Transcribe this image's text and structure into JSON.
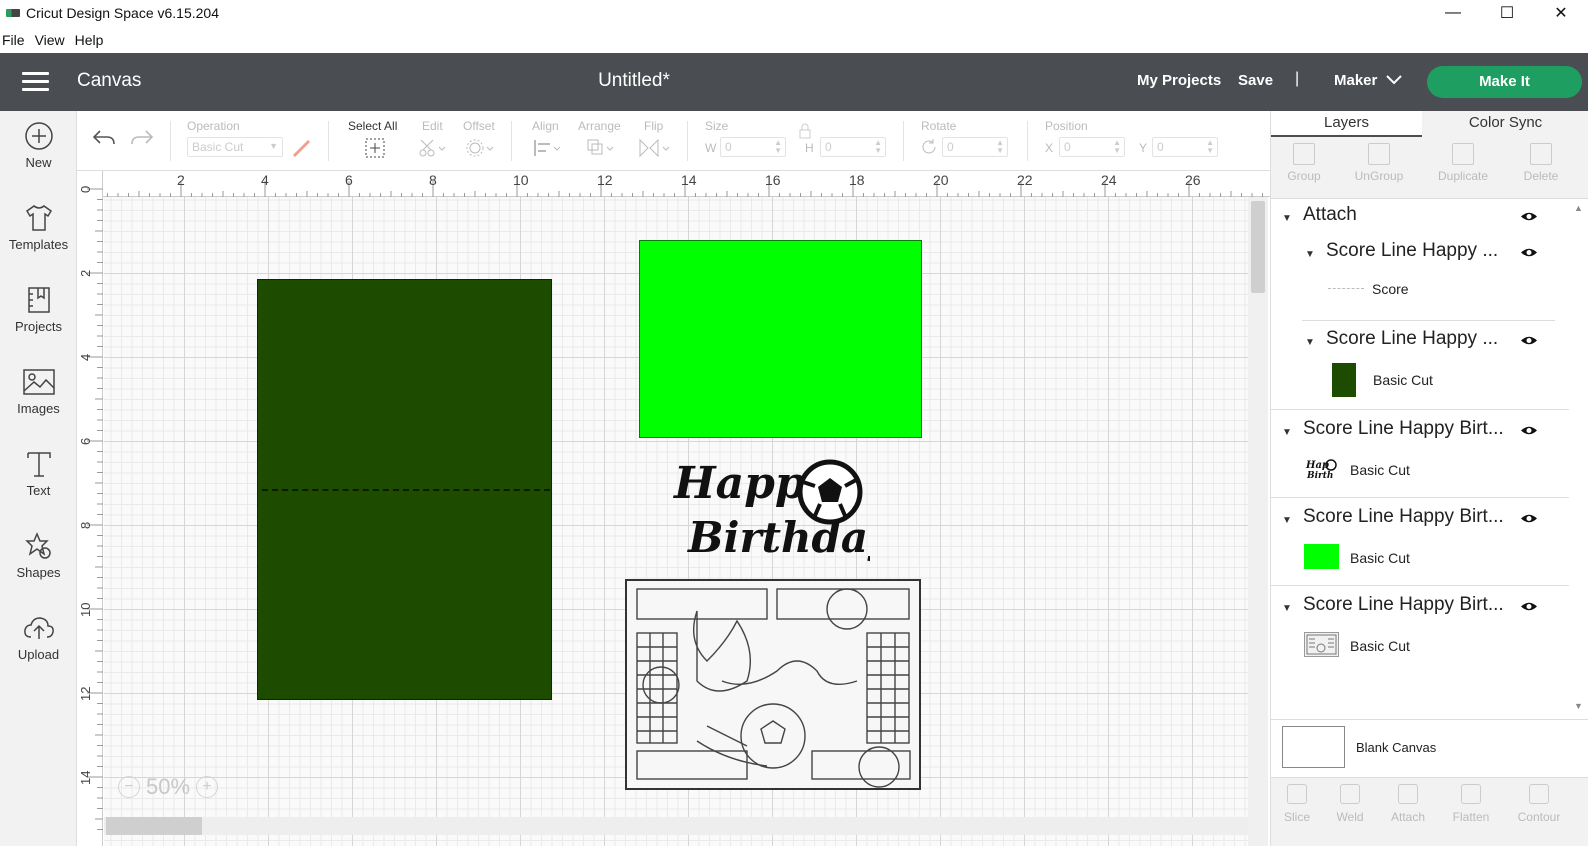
{
  "window": {
    "title": "Cricut Design Space  v6.15.204",
    "minimize": "—",
    "maximize": "☐",
    "close": "✕"
  },
  "menu": [
    "File",
    "View",
    "Help"
  ],
  "header": {
    "section": "Canvas",
    "doc_title": "Untitled*",
    "my_projects": "My Projects",
    "save": "Save",
    "separator": "|",
    "machine": "Maker",
    "make_it": "Make It"
  },
  "sidebar": [
    {
      "label": "New",
      "icon": "plus-circle-icon"
    },
    {
      "label": "Templates",
      "icon": "tshirt-icon"
    },
    {
      "label": "Projects",
      "icon": "projects-icon"
    },
    {
      "label": "Images",
      "icon": "image-icon"
    },
    {
      "label": "Text",
      "icon": "text-icon"
    },
    {
      "label": "Shapes",
      "icon": "shapes-icon"
    },
    {
      "label": "Upload",
      "icon": "upload-cloud-icon"
    }
  ],
  "toolbar": {
    "operation_label": "Operation",
    "operation_value": "Basic Cut",
    "select_all": "Select All",
    "edit": "Edit",
    "offset": "Offset",
    "align": "Align",
    "arrange": "Arrange",
    "flip": "Flip",
    "size": "Size",
    "w_label": "W",
    "w_value": "0",
    "h_label": "H",
    "h_value": "0",
    "rotate": "Rotate",
    "rotate_value": "0",
    "position": "Position",
    "x_label": "X",
    "x_value": "0",
    "y_label": "Y",
    "y_value": "0"
  },
  "ruler": {
    "top": [
      "2",
      "4",
      "6",
      "8",
      "10",
      "12",
      "14",
      "16",
      "18",
      "20",
      "22",
      "24",
      "26"
    ],
    "left": [
      "0",
      "2",
      "4",
      "6",
      "8",
      "10",
      "12",
      "14"
    ]
  },
  "canvas": {
    "zoom": "50%",
    "zoom_minus": "−",
    "zoom_plus": "+",
    "dark_color": "#1d4c00",
    "green_color": "#00ff00"
  },
  "panel": {
    "tabs": [
      "Layers",
      "Color Sync"
    ],
    "tools": [
      "Group",
      "UnGroup",
      "Duplicate",
      "Delete"
    ],
    "layers": [
      {
        "title": "Attach"
      },
      {
        "title": "Score Line Happy ...",
        "sub": "Score"
      },
      {
        "title": "Score Line Happy ...",
        "sub": "Basic Cut"
      },
      {
        "title": "Score Line Happy Birt...",
        "sub": "Basic Cut"
      },
      {
        "title": "Score Line Happy Birt...",
        "sub": "Basic Cut"
      },
      {
        "title": "Score Line Happy Birt...",
        "sub": "Basic Cut"
      }
    ],
    "blank_canvas": "Blank Canvas",
    "bottom_tools": [
      "Slice",
      "Weld",
      "Attach",
      "Flatten",
      "Contour"
    ]
  }
}
